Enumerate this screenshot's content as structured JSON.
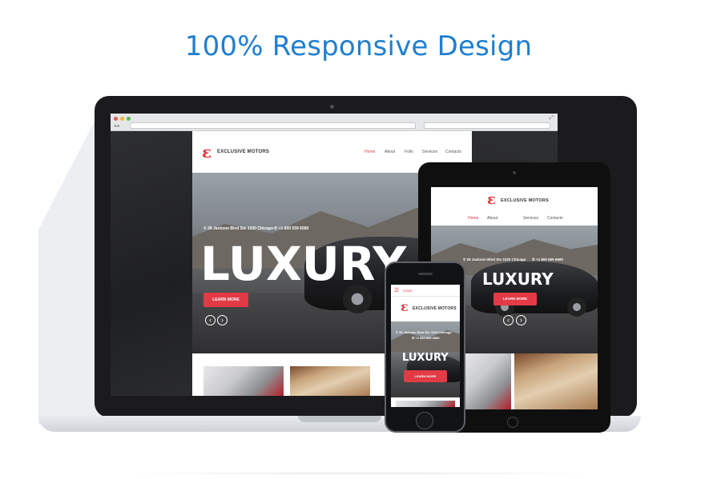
{
  "headline": "100% Responsive Design",
  "brand": {
    "name": "EXCLUSIVE MOTORS",
    "logo_glyph": "ε",
    "accent_color": "#e23b45",
    "headline_color": "#1f7fd0"
  },
  "desktop": {
    "menu": [
      "Home",
      "About",
      "Folio",
      "Services",
      "Contacts"
    ],
    "active_menu": "Home",
    "address": "28 Jackson Blvd Ste 1020 Chicago",
    "phone": "+1 800 559 6580",
    "hero_word": "LUXURY",
    "cta_label": "LEARN MORE",
    "prev_glyph": "‹",
    "next_glyph": "›"
  },
  "tablet": {
    "menu": [
      "Home",
      "About",
      "Services",
      "Contacts"
    ],
    "active_menu": "Home",
    "address": "28 Jackson Blvd Ste 1020 Chicago",
    "phone": "+1 800 559 6580",
    "hero_word": "LUXURY",
    "cta_label": "LEARN MORE",
    "prev_glyph": "‹",
    "next_glyph": "›"
  },
  "phone": {
    "menu_icon": "hamburger-icon",
    "menu_label": "HOME",
    "address": "28 Jackson Blvd Ste 1020 Chicago",
    "phone": "+1 800 559 6580",
    "hero_word": "LUXURY",
    "cta_label": "LEARN MORE"
  }
}
